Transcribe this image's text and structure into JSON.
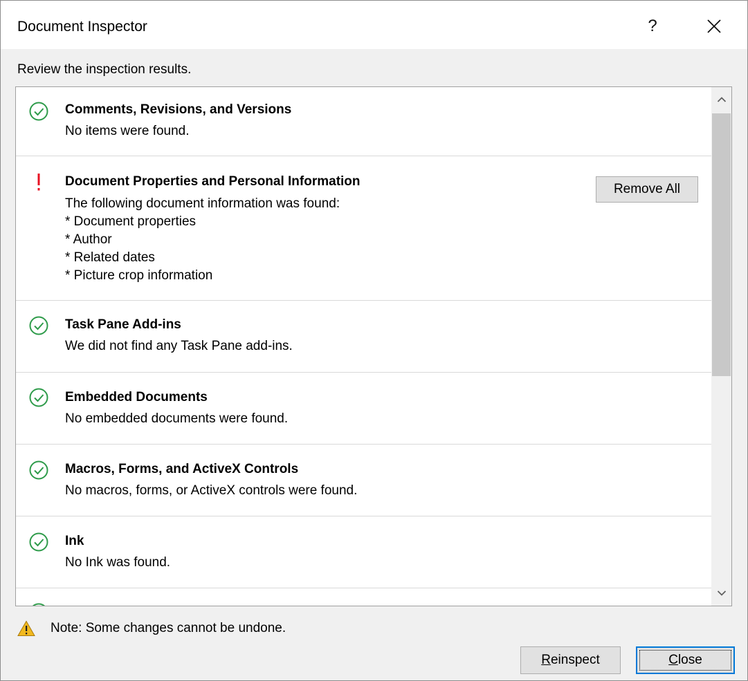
{
  "window": {
    "title": "Document Inspector",
    "help_label": "?",
    "close_glyph": "✕"
  },
  "subtitle": "Review the inspection results.",
  "colors": {
    "ok_green": "#2e9b4a",
    "warning_red": "#e81123",
    "focus_blue": "#0078d7",
    "warn_yellow": "#f2b91e"
  },
  "results": [
    {
      "status": "ok",
      "icon": "check-circle-icon",
      "title": "Comments, Revisions, and Versions",
      "lines": [
        "No items were found."
      ]
    },
    {
      "status": "found",
      "icon": "exclamation-icon",
      "title": "Document Properties and Personal Information",
      "lines": [
        "The following document information was found:",
        "* Document properties",
        "* Author",
        "* Related dates",
        "* Picture crop information"
      ],
      "action_label": "Remove All"
    },
    {
      "status": "ok",
      "icon": "check-circle-icon",
      "title": "Task Pane Add-ins",
      "lines": [
        "We did not find any Task Pane add-ins."
      ]
    },
    {
      "status": "ok",
      "icon": "check-circle-icon",
      "title": "Embedded Documents",
      "lines": [
        "No embedded documents were found."
      ]
    },
    {
      "status": "ok",
      "icon": "check-circle-icon",
      "title": "Macros, Forms, and ActiveX Controls",
      "lines": [
        "No macros, forms, or ActiveX controls were found."
      ]
    },
    {
      "status": "ok",
      "icon": "check-circle-icon",
      "title": "Ink",
      "lines": [
        "No Ink was found."
      ]
    }
  ],
  "note": {
    "icon": "warning-triangle-icon",
    "text": "Note: Some changes cannot be undone."
  },
  "buttons": {
    "reinspect_accel": "R",
    "reinspect_rest": "einspect",
    "close_accel": "C",
    "close_rest": "lose"
  }
}
